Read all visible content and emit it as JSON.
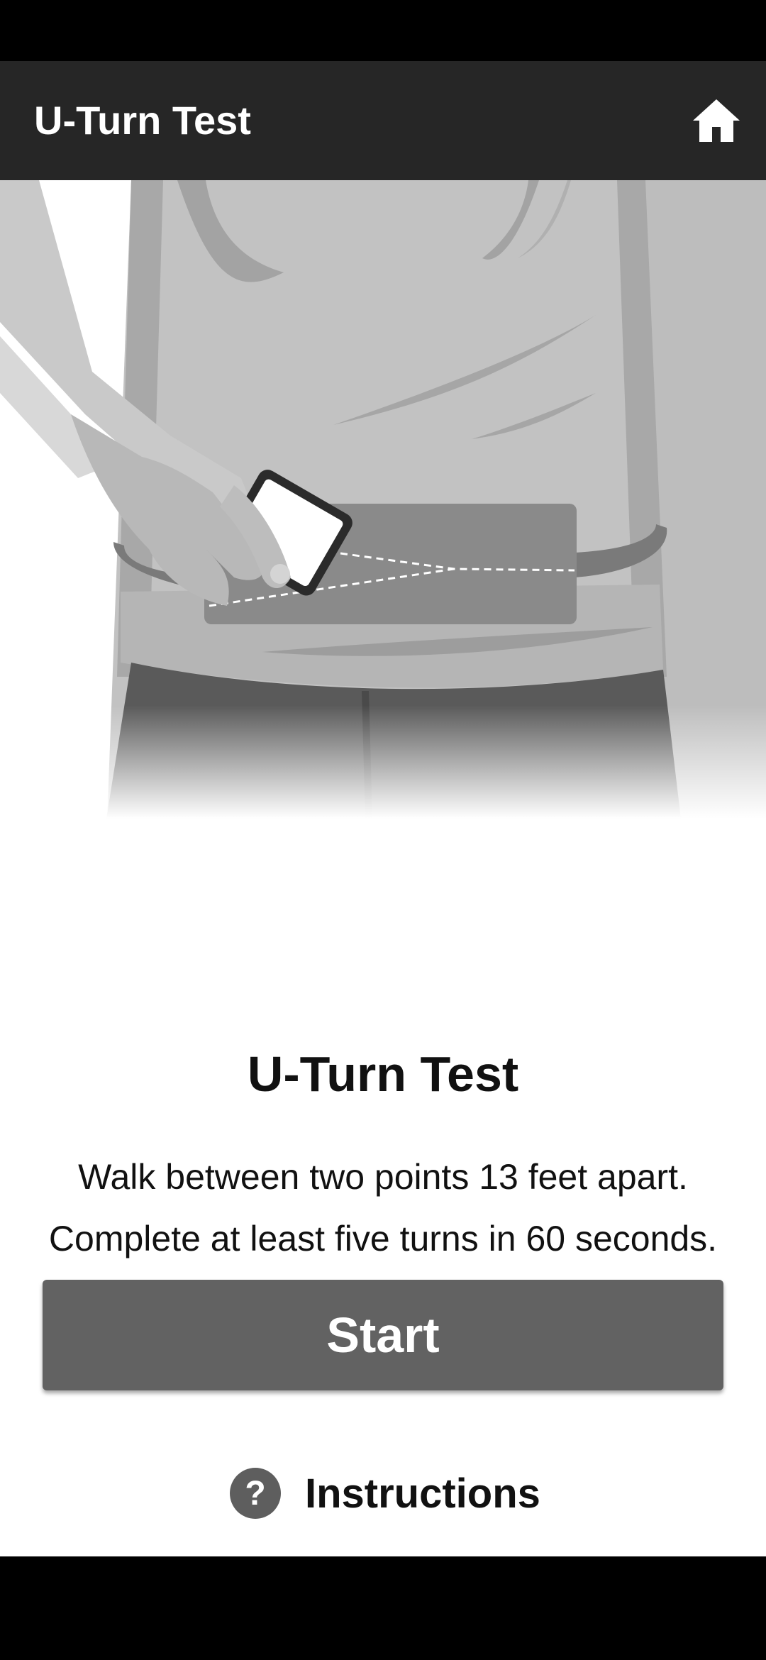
{
  "app_bar": {
    "title": "U-Turn Test",
    "home_icon": "home-icon"
  },
  "main": {
    "illustration": "person-placing-phone-in-waist-pouch",
    "title": "U-Turn Test",
    "description_lines": [
      "Walk between two points 13 feet apart.",
      "Complete at least five turns in 60 seconds."
    ],
    "start_label": "Start",
    "instructions_label": "Instructions",
    "help_icon": "?"
  },
  "colors": {
    "app_bar": "#262626",
    "button": "#626262",
    "background": "#ffffff",
    "system_bars": "#000000"
  }
}
